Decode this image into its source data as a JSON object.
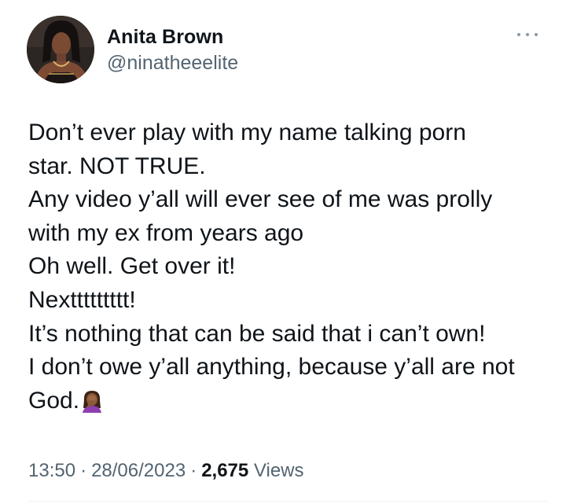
{
  "author": {
    "display_name": "Anita Brown",
    "handle": "@ninatheeelite",
    "avatar_icon": "profile-photo"
  },
  "more_icon": "more-horizontal-icon",
  "tweet": {
    "lines": [
      "Don’t ever play with my name talking porn",
      "star. NOT TRUE.",
      "Any video y’all will ever see of me was prolly",
      "with my ex from years ago",
      "Oh well. Get over it!",
      "Nexttttttttt!",
      "It’s nothing that can be said that i can’t own!",
      "I don’t owe y’all anything, because y’all are not",
      "God."
    ],
    "trailing_emoji": "woman-facepalming-emoji"
  },
  "meta": {
    "time": "13:50",
    "separator": "·",
    "date": "28/06/2023",
    "views_count": "2,675",
    "views_label": "Views"
  },
  "colors": {
    "text_primary": "#0f1419",
    "text_secondary": "#536471",
    "background": "#ffffff"
  }
}
